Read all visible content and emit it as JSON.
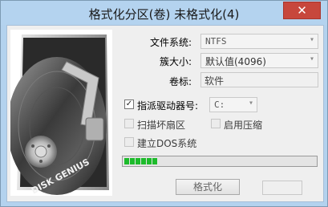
{
  "window": {
    "title": "格式化分区(卷) 未格式化(4)"
  },
  "disk_image": {
    "brand_text": "DISK GENIUS"
  },
  "form": {
    "filesystem_label": "文件系统:",
    "filesystem_value": "NTFS",
    "cluster_label": "簇大小:",
    "cluster_value": "默认值(4096)",
    "volume_label": "卷标:",
    "volume_value": "软件"
  },
  "options": {
    "assign_drive_label": "指派驱动器号:",
    "assign_drive_checked": true,
    "drive_letter_value": "C:",
    "scan_bad_sectors_label": "扫描坏扇区",
    "enable_compression_label": "启用压缩",
    "create_dos_label": "建立DOS系统"
  },
  "progress": {
    "filled_segments": 6,
    "percent": 12
  },
  "buttons": {
    "format_label": "格式化",
    "cancel_label": ""
  },
  "colors": {
    "progress_fill": "#1dbb2b",
    "title_bar": "#b4d3ef",
    "close_button": "#c7473c"
  }
}
